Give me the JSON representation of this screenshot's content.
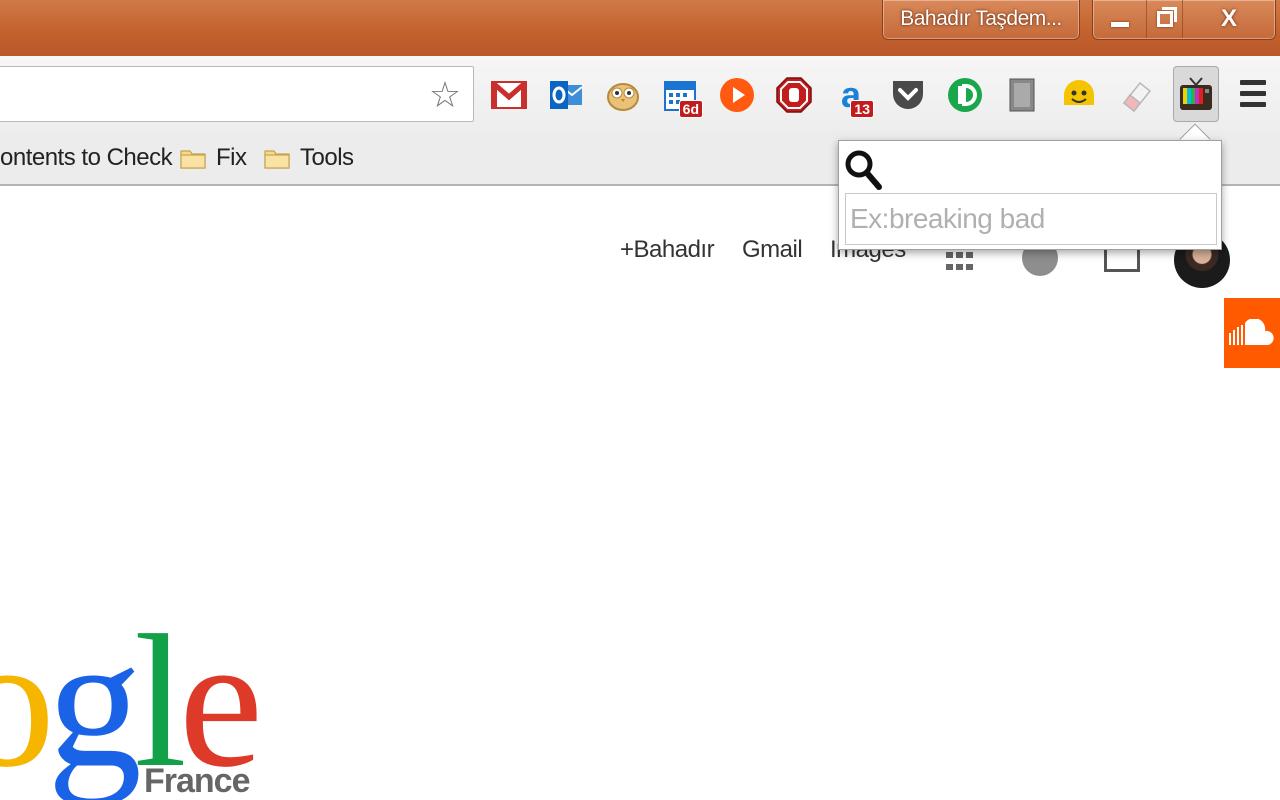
{
  "window": {
    "profile_name": "Bahadır Taşdem...",
    "controls": {
      "close_label": "X"
    }
  },
  "toolbar": {
    "extensions": [
      "gmail-icon",
      "outlook-icon",
      "owl-icon",
      "calendar-icon",
      "play-icon",
      "stop-adblock-icon",
      "amazon-icon",
      "pocket-icon",
      "green-d-icon",
      "trash-icon",
      "smiley-icon",
      "eraser-icon",
      "tv-icon"
    ],
    "badges": {
      "calendar": "6d",
      "amazon": "13"
    }
  },
  "bookmarks": {
    "items": [
      {
        "label": "ontents to Check"
      },
      {
        "label": "Fix"
      },
      {
        "label": "Tools"
      }
    ]
  },
  "google_bar": {
    "plus_name": "+Bahadır",
    "gmail": "Gmail",
    "images": "Images"
  },
  "popup": {
    "placeholder": "Ex:breaking bad",
    "value": ""
  },
  "logo": {
    "letters": [
      "o",
      "g",
      "l",
      "e"
    ],
    "region": "France"
  },
  "colors": {
    "titlebar": "#c4622e",
    "soundcloud": "#ff5a00",
    "logo_yellow": "#f6b600",
    "logo_blue": "#1b63e6",
    "logo_green": "#12a148",
    "logo_red": "#dd3a2a"
  }
}
